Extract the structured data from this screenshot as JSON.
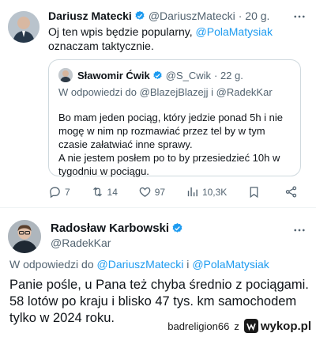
{
  "tweet1": {
    "author_name": "Dariusz Matecki",
    "author_handle": "@DariuszMatecki",
    "time": "· 20 g.",
    "text_before": "Oj ten wpis będzie popularny, ",
    "mention": "@PolaMatysiak",
    "text_after": " oznaczam taktycznie.",
    "quote": {
      "author_name": "Sławomir Ćwik",
      "author_handle": "@S_Cwik",
      "time": "· 22 g.",
      "reply_prefix": "W odpowiedzi do ",
      "reply_to_1": "@BlazejBlazejj",
      "reply_join": " i ",
      "reply_to_2": "@RadekKar",
      "paragraph_1": "Bo mam jeden pociąg, który jedzie ponad 5h i nie mogę w nim np rozmawiać przez tel by w tym czasie załatwiać inne sprawy.",
      "paragraph_2": "A nie jestem posłem po to by przesiedzieć 10h w tygodniu w pociągu."
    },
    "actions": {
      "replies": "7",
      "retweets": "14",
      "likes": "97",
      "views": "10,3K"
    }
  },
  "tweet2": {
    "author_name": "Radosław Karbowski",
    "author_handle": "@RadekKar",
    "reply_prefix": "W odpowiedzi do ",
    "reply_to_1": "@DariuszMatecki",
    "reply_join": " i ",
    "reply_to_2": "@PolaMatysiak",
    "text": "Panie pośle, u Pana też chyba średnio z pociągami. 58 lotów po kraju i blisko 47 tys. km samochodem tylko w 2024 roku."
  },
  "watermark": {
    "user": "badreligion66",
    "z": "z",
    "site": "wykop.pl"
  },
  "colors": {
    "link": "#1d9bf0",
    "muted": "#536471",
    "text": "#0f1419",
    "border": "#cfd9de"
  },
  "icons": [
    "more-icon",
    "verified-badge-icon",
    "reply-icon",
    "retweet-icon",
    "like-icon",
    "views-icon",
    "bookmark-icon",
    "share-icon",
    "wykop-logo-icon"
  ]
}
